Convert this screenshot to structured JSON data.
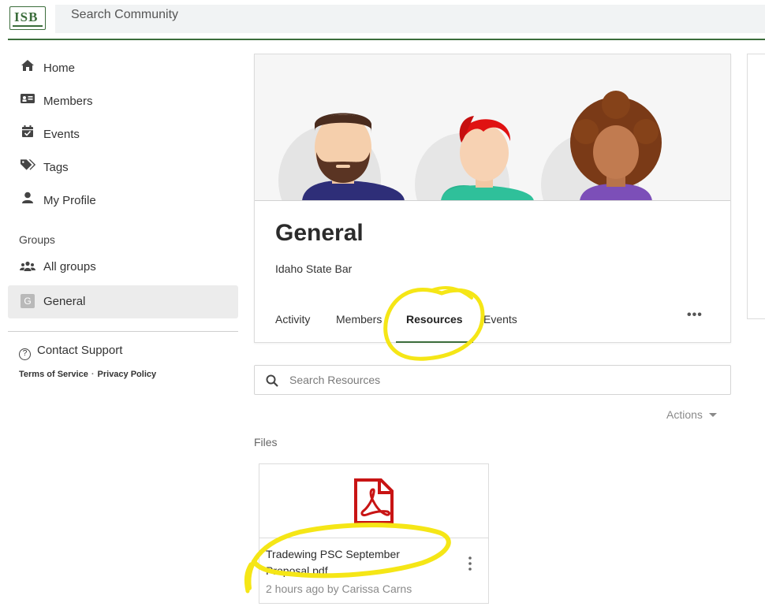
{
  "header": {
    "logo_text": "ISB",
    "search_label": "Search Community"
  },
  "sidebar": {
    "items": [
      {
        "label": "Home",
        "icon": "home-icon"
      },
      {
        "label": "Members",
        "icon": "id-card-icon"
      },
      {
        "label": "Events",
        "icon": "calendar-icon"
      },
      {
        "label": "Tags",
        "icon": "tags-icon"
      },
      {
        "label": "My Profile",
        "icon": "user-icon"
      }
    ],
    "groups_heading": "Groups",
    "groups": [
      {
        "label": "All groups",
        "icon": "users-icon"
      },
      {
        "label": "General",
        "badge": "G"
      }
    ],
    "support_label": "Contact Support",
    "terms_label": "Terms of Service",
    "privacy_label": "Privacy Policy"
  },
  "group": {
    "title": "General",
    "org": "Idaho State Bar",
    "tabs": [
      {
        "label": "Activity"
      },
      {
        "label": "Members"
      },
      {
        "label": "Resources"
      },
      {
        "label": "Events"
      }
    ],
    "active_tab": "Resources",
    "more_label": "•••"
  },
  "resources": {
    "search_placeholder": "Search Resources",
    "actions_label": "Actions",
    "files_heading": "Files",
    "files": [
      {
        "name": "Tradewing PSC September Proposal.pdf",
        "meta": "2 hours ago by Carissa Carns",
        "icon": "pdf-file-icon"
      }
    ]
  },
  "colors": {
    "brand_green": "#3b6d3b",
    "pdf_red": "#c81414",
    "highlight_yellow": "#f5e616"
  }
}
